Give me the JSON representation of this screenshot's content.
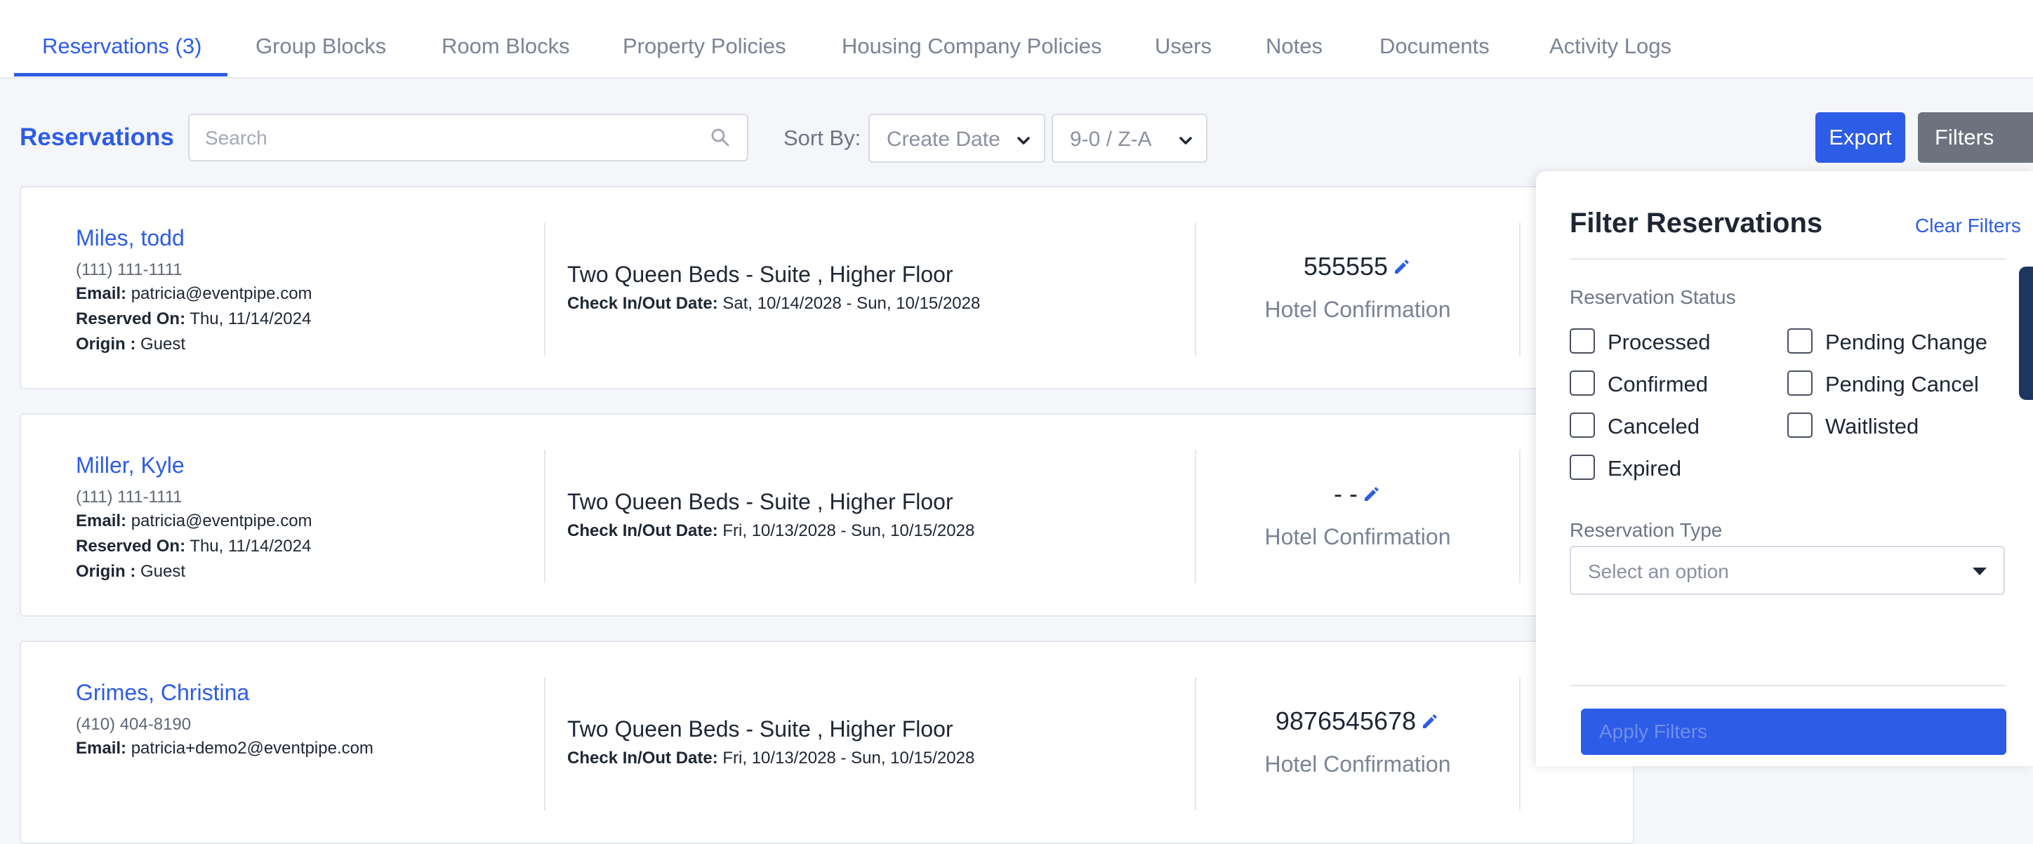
{
  "tabs": [
    {
      "label": "Reservations (3)",
      "active": true
    },
    {
      "label": "Group Blocks"
    },
    {
      "label": "Room Blocks"
    },
    {
      "label": "Property Policies"
    },
    {
      "label": "Housing Company Policies"
    },
    {
      "label": "Users"
    },
    {
      "label": "Notes"
    },
    {
      "label": "Documents"
    },
    {
      "label": "Activity Logs"
    }
  ],
  "toolbar": {
    "title": "Reservations",
    "search_placeholder": "Search",
    "sort_label": "Sort By:",
    "sort_field": "Create Date",
    "sort_order": "9-0 / Z-A",
    "export_label": "Export",
    "filters_label": "Filters"
  },
  "reservations": [
    {
      "name": "Miles, todd",
      "phone": "(111) 111-1111",
      "email_label": "Email:",
      "email": "patricia@eventpipe.com",
      "reserved_label": "Reserved On:",
      "reserved_on": "Thu, 11/14/2024",
      "origin_label": "Origin :",
      "origin": "Guest",
      "room": "Two Queen Beds - Suite , Higher Floor",
      "dates_label": "Check In/Out Date:",
      "dates": "Sat, 10/14/2028 - Sun, 10/15/2028",
      "confirmation": "555555",
      "confirmation_label": "Hotel Confirmation"
    },
    {
      "name": "Miller, Kyle",
      "phone": "(111) 111-1111",
      "email_label": "Email:",
      "email": "patricia@eventpipe.com",
      "reserved_label": "Reserved On:",
      "reserved_on": "Thu, 11/14/2024",
      "origin_label": "Origin :",
      "origin": "Guest",
      "room": "Two Queen Beds - Suite , Higher Floor",
      "dates_label": "Check In/Out Date:",
      "dates": "Fri, 10/13/2028 - Sun, 10/15/2028",
      "confirmation": "- -",
      "confirmation_label": "Hotel Confirmation"
    },
    {
      "name": "Grimes, Christina",
      "phone": "(410) 404-8190",
      "email_label": "Email:",
      "email": "patricia+demo2@eventpipe.com",
      "room": "Two Queen Beds - Suite , Higher Floor",
      "dates_label": "Check In/Out Date:",
      "dates": "Fri, 10/13/2028 - Sun, 10/15/2028",
      "confirmation": "9876545678",
      "confirmation_label": "Hotel Confirmation"
    }
  ],
  "filter_panel": {
    "title": "Filter Reservations",
    "clear_label": "Clear Filters",
    "status_label": "Reservation Status",
    "statuses": [
      "Processed",
      "Pending Change",
      "Confirmed",
      "Pending Cancel",
      "Canceled",
      "Waitlisted",
      "Expired"
    ],
    "type_label": "Reservation Type",
    "type_placeholder": "Select an option",
    "apply_label": "Apply Filters"
  },
  "colors": {
    "accent": "#2d5ce6",
    "filters_button": "#6c737f",
    "text": "#1f2633",
    "muted": "#7c8395"
  }
}
